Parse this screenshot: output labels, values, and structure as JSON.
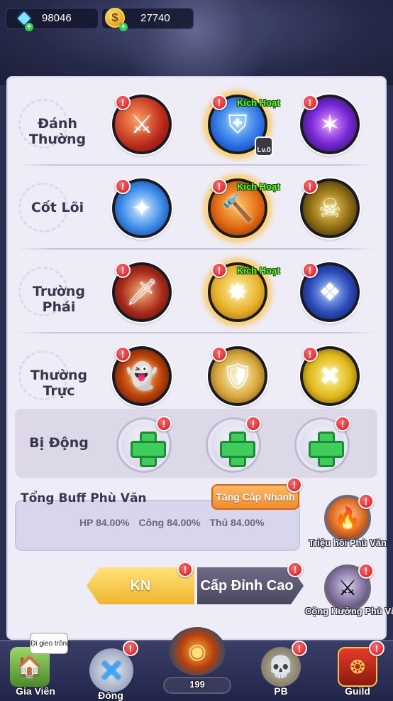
{
  "resources": {
    "gems": "98046",
    "gold": "27740"
  },
  "rows": [
    {
      "label": "Đánh Thường",
      "skills": [
        {
          "icon": "slash-icon",
          "active": false
        },
        {
          "icon": "shield-icon",
          "active": true,
          "tag": "Kích Hoạt",
          "level": "Lv.0"
        },
        {
          "icon": "purple-burst-icon",
          "active": false
        }
      ]
    },
    {
      "label": "Cốt Lõi",
      "skills": [
        {
          "icon": "shatter-icon",
          "active": false
        },
        {
          "icon": "fire-hammer-icon",
          "active": true,
          "tag": "Kích Hoạt"
        },
        {
          "icon": "chained-skull-icon",
          "active": false
        }
      ]
    },
    {
      "label": "Trường Phái",
      "skills": [
        {
          "icon": "sword-icon",
          "active": false
        },
        {
          "icon": "golden-spikes-icon",
          "active": true,
          "tag": "Kích Hoạt"
        },
        {
          "icon": "blue-fang-icon",
          "active": false
        }
      ]
    },
    {
      "label": "Thường Trực",
      "skills": [
        {
          "icon": "flame-ghost-icon",
          "active": false
        },
        {
          "icon": "silver-shield-icon",
          "active": false
        },
        {
          "icon": "dizzy-figure-icon",
          "active": false
        }
      ]
    }
  ],
  "passive": {
    "label": "Bị Động",
    "slots": 3
  },
  "buff": {
    "title": "Tổng Buff Phù Văn",
    "hp": "HP 84.00%",
    "atk": "Công 84.00%",
    "def": "Thủ 84.00%",
    "quick_upgrade": "Tăng Cấp Nhanh"
  },
  "side_buttons": {
    "summon": "Triệu hồi Phù Văn",
    "resonance": "Cộng Hưởng Phù Văn"
  },
  "actions": {
    "kn": "KN",
    "max_level": "Cấp Đỉnh Cao"
  },
  "bottom_nav": {
    "tooltip": "Đi gieo trồng",
    "garden": "Gia Viên",
    "close": "Đóng",
    "energy": "199",
    "dungeon": "PB",
    "guild": "Guild"
  },
  "colors": {
    "badge_red": "#d4141e",
    "activate_green": "#5dff3a",
    "panel_bg": "#eeedf7"
  }
}
